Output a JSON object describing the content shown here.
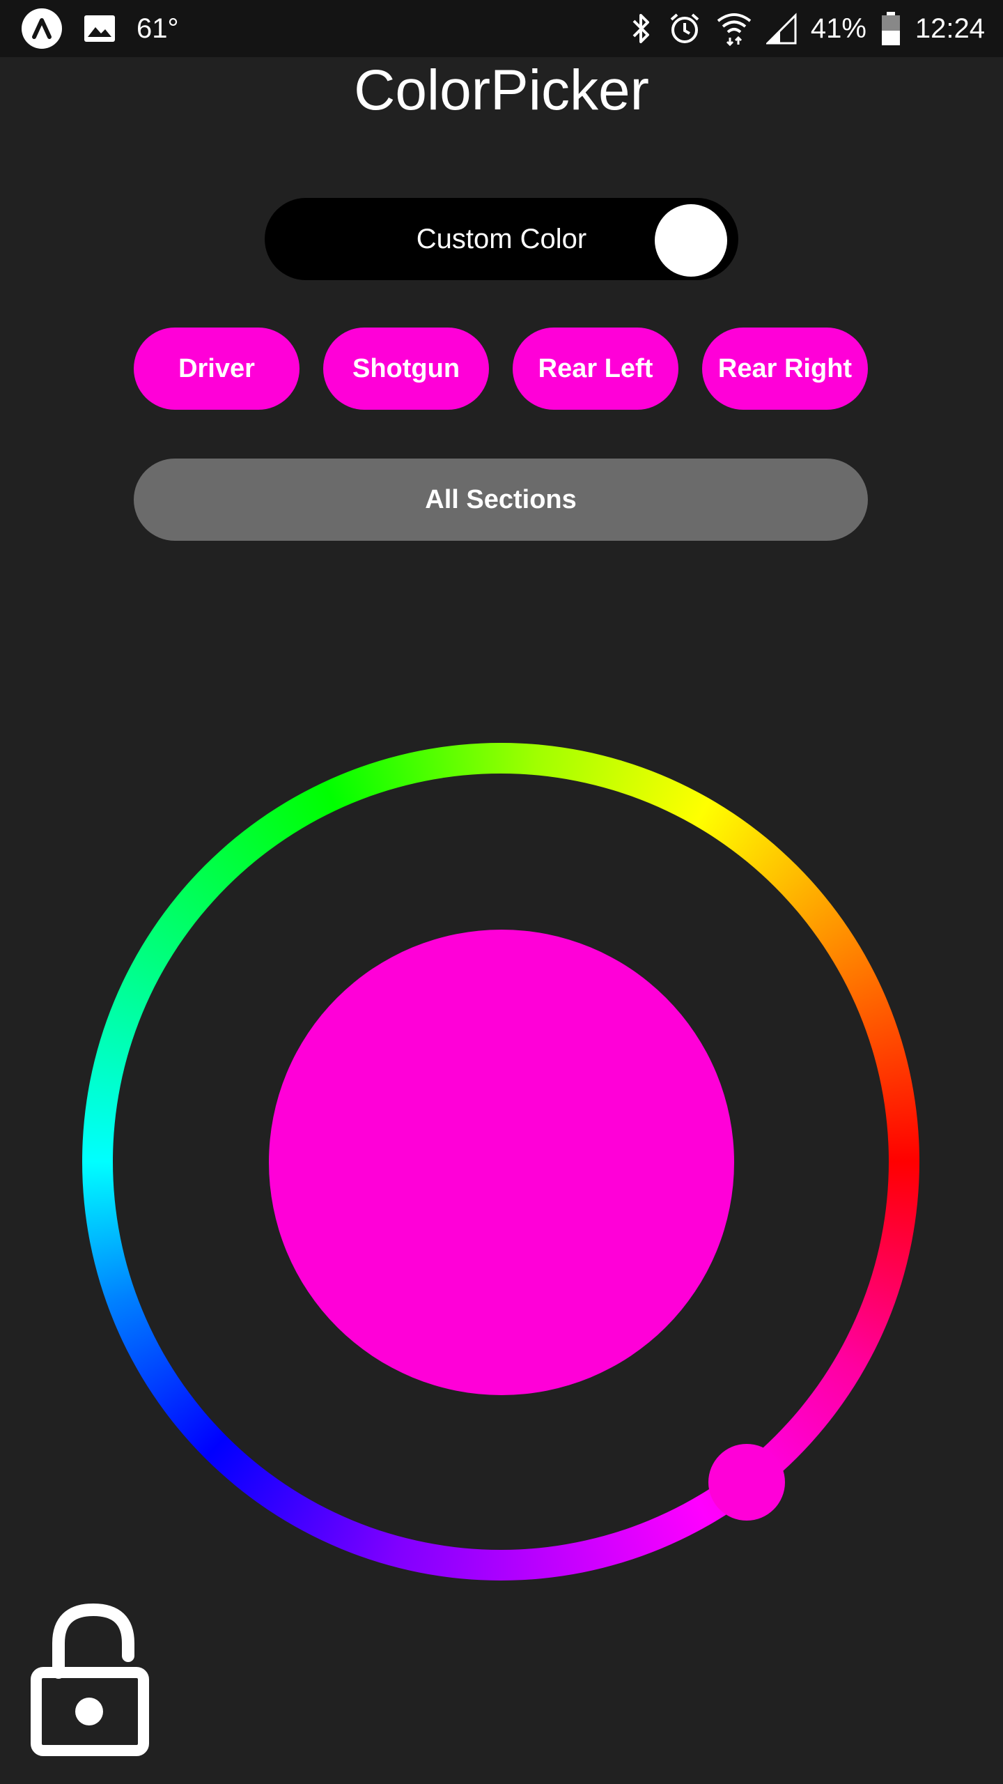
{
  "status_bar": {
    "weather": "61°",
    "battery": "41%",
    "time": "12:24",
    "icons": [
      "app-icon",
      "image-icon",
      "bluetooth-icon",
      "alarm-icon",
      "wifi-icon",
      "signal-icon",
      "battery-icon"
    ]
  },
  "header": {
    "title": "ColorPicker"
  },
  "toggle": {
    "label": "Custom Color",
    "on": true
  },
  "sections": {
    "buttons": [
      {
        "label": "Driver"
      },
      {
        "label": "Shotgun"
      },
      {
        "label": "Rear Left"
      },
      {
        "label": "Rear Right"
      }
    ],
    "all_label": "All Sections"
  },
  "colors": {
    "accent": "#ff00d8",
    "background": "#212121",
    "all_button": "#6b6b6b",
    "selected_color": "#ff00d8"
  },
  "lock": {
    "icon": "unlock-icon"
  }
}
